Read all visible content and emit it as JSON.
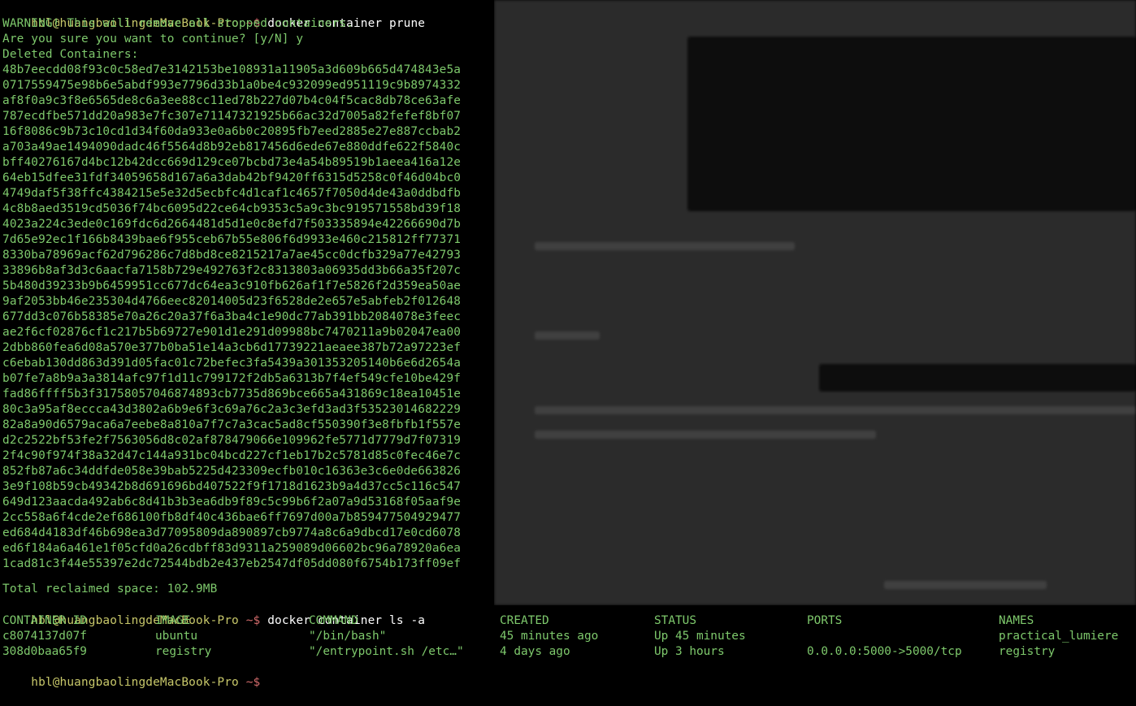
{
  "prompt": {
    "host": "hbl@huangbaolingdeMacBook-Pro",
    "path": "~",
    "symbol": "$"
  },
  "commands": {
    "prune": "docker container prune",
    "ls": "docker container ls -a"
  },
  "prune_output": {
    "warning": "WARNING! This will remove all stopped containers.",
    "confirm": "Are you sure you want to continue? [y/N] y",
    "deleted_header": "Deleted Containers:",
    "container_ids": [
      "48b7eecdd08f93c0c58ed7e3142153be108931a11905a3d609b665d474843e5a",
      "0717559475e98b6e5abdf993e7796d33b1a0be4c932099ed951119c9b8974332",
      "af8f0a9c3f8e6565de8c6a3ee88cc11ed78b227d07b4c04f5cac8db78ce63afe",
      "787ecdfbe571dd20a983e7fc307e71147321925b66ac32d7005a82fefef8bf07",
      "16f8086c9b73c10cd1d34f60da933e0a6b0c20895fb7eed2885e27e887ccbab2",
      "a703a49ae1494090dadc46f5564d8b92eb817456d6ede67e880ddfe622f5840c",
      "bff40276167d4bc12b42dcc669d129ce07bcbd73e4a54b89519b1aeea416a12e",
      "64eb15dfee31fdf34059658d167a6a3dab42bf9420ff6315d5258c0f46d04bc0",
      "4749daf5f38ffc4384215e5e32d5ecbfc4d1caf1c4657f7050d4de43a0ddbdfb",
      "4c8b8aed3519cd5036f74bc6095d22ce64cb9353c5a9c3bc919571558bd39f18",
      "4023a224c3ede0c169fdc6d2664481d5d1e0c8efd7f503335894e42266690d7b",
      "7d65e92ec1f166b8439bae6f955ceb67b55e806f6d9933e460c215812ff77371",
      "8330ba78969acf62d796286c7d8bd8ce8215217a7ae45cc0dcfb329a77e42793",
      "33896b8af3d3c6aacfa7158b729e492763f2c8313803a06935dd3b66a35f207c",
      "5b480d39233b9b6459951cc677dc64ea3c910fb626af1f7e5826f2d359ea50ae",
      "9af2053bb46e235304d4766eec82014005d23f6528de2e657e5abfeb2f012648",
      "677dd3c076b58385e70a26c20a37f6a3ba4c1e90dc77ab391bb2084078e3feec",
      "ae2f6cf02876cf1c217b5b69727e901d1e291d09988bc7470211a9b02047ea00",
      "2dbb860fea6d08a570e377b0ba51e14a3cb6d17739221aeaee387b72a97223ef",
      "c6ebab130dd863d391d05fac01c72befec3fa5439a301353205140b6e6d2654a",
      "b07fe7a8b9a3a3814afc97f1d11c799172f2db5a6313b7f4ef549cfe10be429f",
      "fad86ffff5b3f31758057046874893cb7735d869bce665a431869c18ea10451e",
      "80c3a95af8eccca43d3802a6b9e6f3c69a76c2a3c3efd3ad3f53523014682229",
      "82a8a90d6579aca6a7eebe8a810a7f7c7a3cac5ad8cf550390f3e8fbfb1f557e",
      "d2c2522bf53fe2f7563056d8c02af878479066e109962fe5771d7779d7f07319",
      "2f4c90f974f38a32d47c144a931bc04bcd227cf1eb17b2c5781d85c0fec46e7c",
      "852fb87a6c34ddfde058e39bab5225d423309ecfb010c16363e3c6e0de663826",
      "3e9f108b59cb49342b8d691696bd407522f9f1718d1623b9a4d37cc5c116c547",
      "649d123aacda492ab6c8d41b3b3ea6db9f89c5c99b6f2a07a9d53168f05aaf9e",
      "2cc558a6f4cde2ef686100fb8df40c436bae6ff7697d00a7b859477504929477",
      "ed684d4183df46b698ea3d77095809da890897cb9774a8c6a9dbcd17e0cd6078",
      "ed6f184a6a461e1f05cfd0a26cdbff83d9311a259089d06602bc96a78920a6ea",
      "1cad81c3f44e55397e2dc72544bdb2e437eb2547df05dd080f6754b173ff09ef"
    ],
    "total": "Total reclaimed space: 102.9MB"
  },
  "ls_output": {
    "headers": [
      "CONTAINER ID",
      "IMAGE",
      "COMMAND",
      "CREATED",
      "STATUS",
      "PORTS",
      "NAMES"
    ],
    "rows": [
      [
        "c8074137d07f",
        "ubuntu",
        "\"/bin/bash\"",
        "45 minutes ago",
        "Up 45 minutes",
        "",
        "practical_lumiere"
      ],
      [
        "308d0baa65f9",
        "registry",
        "\"/entrypoint.sh /etc…\"",
        "4 days ago",
        "Up 3 hours",
        "0.0.0.0:5000->5000/tcp",
        "registry"
      ]
    ]
  },
  "colors": {
    "background": "#000000",
    "text": "#7ec96c",
    "prompt_host": "#c8c86a",
    "prompt_symbol": "#d26b6b",
    "command": "#ffffff"
  }
}
